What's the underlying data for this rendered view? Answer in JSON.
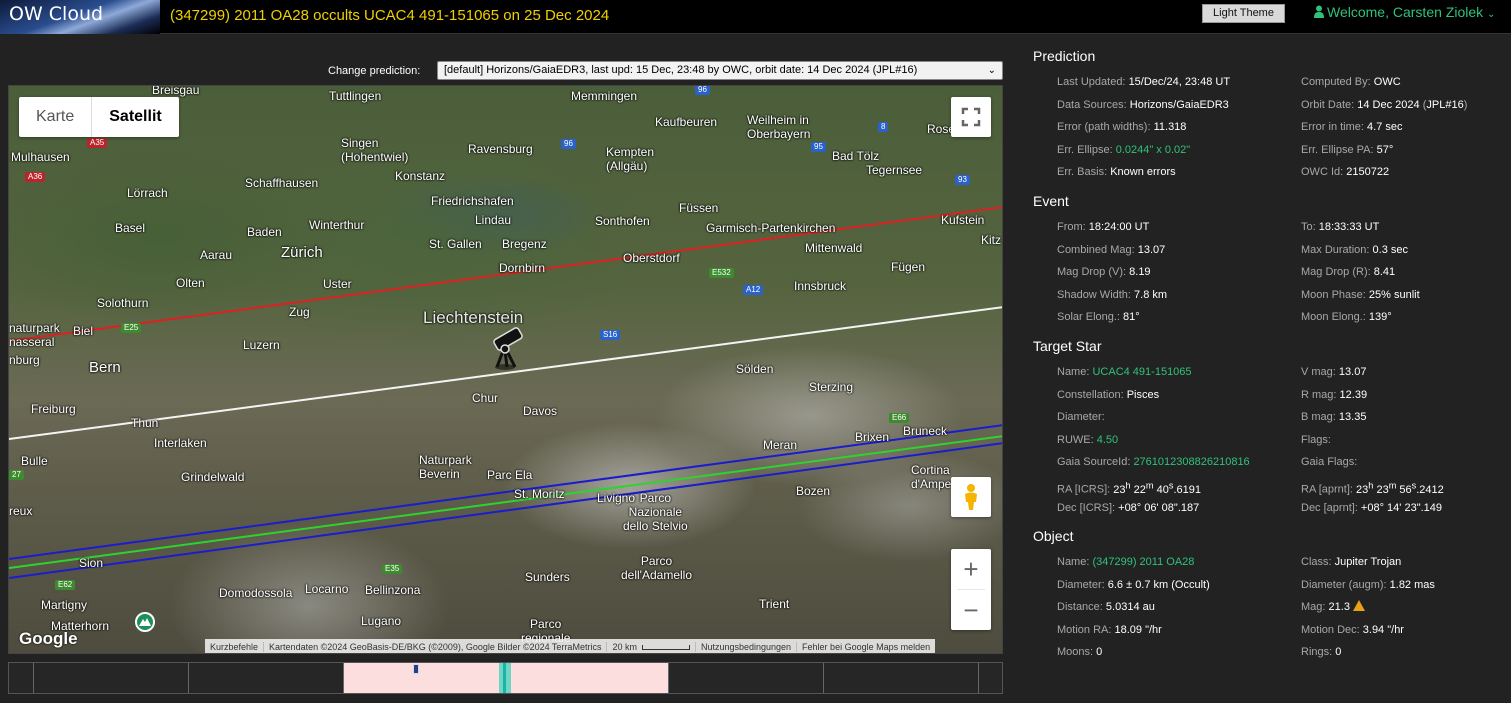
{
  "header": {
    "logo": "OW Cloud",
    "event_title": "(347299) 2011 OA28 occults UCAC4 491-151065 on 25 Dec 2024",
    "theme_button": "Light Theme",
    "welcome": "Welcome, Carsten Ziolek",
    "accent": "#2fc27a",
    "title_color": "#f0d000"
  },
  "prediction_selector": {
    "label": "Change prediction:",
    "selected": "[default] Horizons/GaiaEDR3, last upd: 15 Dec, 23:48 by OWC, orbit date: 14 Dec 2024 (JPL#16)"
  },
  "map": {
    "type_buttons": [
      "Karte",
      "Satellit"
    ],
    "active_type": "Satellit",
    "labels": {
      "breisgau": "Breisgau",
      "tuttlingen": "Tuttlingen",
      "memmingen": "Memmingen",
      "mulhausen": "Mulhausen",
      "singen": "Singen\n(Hohentwiel)",
      "ravensburg": "Ravensburg",
      "kaufbeuren": "Kaufbeuren",
      "weilheim": "Weilheim in\nOberbayern",
      "kempten": "Kempten\n(Allgäu)",
      "badtolz": "Bad Tölz",
      "tegernsee": "Tegernsee",
      "rosenheim": "Rose",
      "schaffhausen": "Schaffhausen",
      "konstanz": "Konstanz",
      "lorrach": "Lörrach",
      "friedrichshafen": "Friedrichshafen",
      "lindau": "Lindau",
      "sonthofen": "Sonthofen",
      "fussen": "Füssen",
      "kufstein": "Kufstein",
      "winterthur": "Winterthur",
      "basel": "Basel",
      "baden": "Baden",
      "garmisch": "Garmisch-Partenkirchen",
      "kitz": "Kitz",
      "aarau": "Aarau",
      "zurich": "Zürich",
      "stgallen": "St. Gallen",
      "bregenz": "Bregenz",
      "mittenwald": "Mittenwald",
      "dornbirn": "Dornbirn",
      "oberstdorf": "Oberstdorf",
      "fugen": "Fügen",
      "olten": "Olten",
      "uster": "Uster",
      "innsbruck": "Innsbruck",
      "solothurn": "Solothurn",
      "liechtenstein": "Liechtenstein",
      "naturpark": "naturpark",
      "biel": "Biel",
      "nasseral": "nasseral",
      "zug": "Zug",
      "luzern": "Luzern",
      "bern": "Bern",
      "solden": "Sölden",
      "chur": "Chur",
      "sterzing": "Sterzing",
      "freiburg": "Freiburg",
      "thun": "Thun",
      "davos": "Davos",
      "interlaken": "Interlaken",
      "meran": "Meran",
      "brixen": "Brixen",
      "bruneck": "Bruneck",
      "bulle": "Bulle",
      "naturpark_bev": "Naturpark\nBeverin",
      "pareela": "Parc Ela",
      "grindelwald": "Grindelwald",
      "cortina": "Cortina\nd'Ampe",
      "stmoritz": "St. Moritz",
      "livigno": "Livigno",
      "stelvio": "Parco\nNazionale\ndello Stelvio",
      "bozen": "Bozen",
      "sion": "Sion",
      "sunders": "Sunders",
      "adamello": "Parco\ndell'Adamello",
      "domodossola": "Domodossola",
      "locarno": "Locarno",
      "bellinzona": "Bellinzona",
      "trient": "Trient",
      "martigny": "Martigny",
      "matterhorn": "Matterhorn",
      "lugano": "Lugano",
      "parco_reg": "Parco\nregionale",
      "reux": "reux",
      "nburg": "nburg"
    },
    "roads": [
      "96",
      "A35",
      "A36",
      "96",
      "95",
      "8",
      "93",
      "E532",
      "A12",
      "S16",
      "E25",
      "E66",
      "27",
      "E62",
      "E35"
    ],
    "controls": {
      "fullscreen": "fullscreen-icon",
      "pegman": "pegman-icon",
      "zoom_in": "+",
      "zoom_out": "−"
    },
    "google": "Google",
    "attribution": [
      "Kurzbefehle",
      "Kartendaten ©2024 GeoBasis-DE/BKG (©2009), Google Bilder ©2024 TerraMetrics",
      "20 km",
      "Nutzungsbedingungen",
      "Fehler bei Google Maps melden"
    ],
    "line_colors": {
      "north_limit": "#e02020",
      "center": "#f4f4f4",
      "uncertainty": "#1c1ccf",
      "south_limit": "#2fd32f"
    }
  },
  "panel": {
    "prediction": {
      "title": "Prediction",
      "rows": [
        {
          "l": "Last Updated:",
          "v": "15/Dec/24, 23:48 UT",
          "l2": "Computed By:",
          "v2": "OWC"
        },
        {
          "l": "Data Sources:",
          "v": "Horizons/GaiaEDR3",
          "l2": "Orbit Date:",
          "v2": "14 Dec 2024",
          "v2b": "(",
          "v2c": "JPL#16",
          "v2d": ")"
        },
        {
          "l": "Error (path widths):",
          "v": "11.318",
          "l2": "Error in time:",
          "v2": "4.7 sec"
        },
        {
          "l": "Err. Ellipse:",
          "v": "0.0244\" x 0.02\"",
          "l2": "Err. Ellipse PA:",
          "v2": "57°"
        },
        {
          "l": "Err. Basis:",
          "v": "Known errors",
          "l2": "OWC Id:",
          "v2": "2150722"
        }
      ]
    },
    "event": {
      "title": "Event",
      "rows": [
        {
          "l": "From:",
          "v": "18:24:00 UT",
          "l2": "To:",
          "v2": "18:33:33 UT"
        },
        {
          "l": "Combined Mag:",
          "v": "13.07",
          "l2": "Max Duration:",
          "v2": "0.3 sec"
        },
        {
          "l": "Mag Drop (V):",
          "v": "8.19",
          "l2": "Mag Drop (R):",
          "v2": "8.41"
        },
        {
          "l": "Shadow Width:",
          "v": "7.8 km",
          "l2": "Moon Phase:",
          "v2": "25% sunlit"
        },
        {
          "l": "Solar Elong.:",
          "v": "81°",
          "l2": "Moon Elong.:",
          "v2": "139°"
        }
      ]
    },
    "target_star": {
      "title": "Target Star",
      "rows": [
        {
          "l": "Name:",
          "v": "UCAC4 491-151065",
          "l2": "V mag:",
          "v2": "13.07"
        },
        {
          "l": "Constellation:",
          "v": "Pisces",
          "l2": "R mag:",
          "v2": "12.39"
        },
        {
          "l": "Diameter:",
          "v": "",
          "l2": "B mag:",
          "v2": "13.35"
        },
        {
          "l": "RUWE:",
          "v": "4.50",
          "l2": "Flags:",
          "v2": ""
        },
        {
          "l": "Gaia SourceId:",
          "v": "2761012308826210816",
          "l2": "Gaia Flags:",
          "v2": ""
        }
      ],
      "ra_icrs": {
        "l": "RA [ICRS]:",
        "h": "23",
        "m": "22",
        "s": "40",
        "frac": ".6191"
      },
      "ra_aprnt": {
        "l": "RA [aprnt]:",
        "h": "23",
        "m": "23",
        "s": "56",
        "frac": ".2412"
      },
      "dec_icrs": {
        "l": "Dec [ICRS]:",
        "d": "+08°",
        "m": "06",
        "s": "08",
        "frac": ".187"
      },
      "dec_aprnt": {
        "l": "Dec [aprnt]:",
        "d": "+08°",
        "m": "14",
        "s": "23",
        "frac": ".149"
      }
    },
    "object": {
      "title": "Object",
      "rows": [
        {
          "l": "Name:",
          "v": "(347299) 2011 OA28",
          "l2": "Class:",
          "v2": "Jupiter Trojan"
        },
        {
          "l": "Diameter:",
          "v": "6.6 ± 0.7 km",
          "vb": "(Occult)",
          "l2": "Diameter (augm):",
          "v2": "1.82 mas"
        },
        {
          "l": "Distance:",
          "v": "5.0314 au",
          "l2": "Mag:",
          "v2": "21.3"
        },
        {
          "l": "Motion RA:",
          "v": "18.09 \"/hr",
          "l2": "Motion Dec:",
          "v2": "3.94 \"/hr"
        },
        {
          "l": "Moons:",
          "v": "0",
          "l2": "Rings:",
          "v2": "0"
        }
      ]
    }
  }
}
